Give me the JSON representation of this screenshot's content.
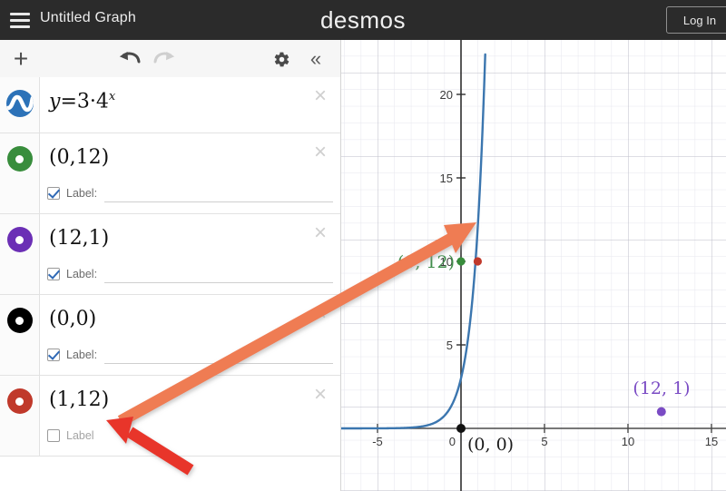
{
  "header": {
    "menu_icon": "hamburger-icon",
    "title": "Untitled Graph",
    "logo": "desmos",
    "login_label": "Log In"
  },
  "toolbar": {
    "add_label": "+",
    "undo_icon": "undo-arrow-icon",
    "redo_icon": "redo-arrow-icon",
    "settings_icon": "gear-icon",
    "collapse_icon": "double-chevron-left-icon",
    "collapse_label": "«"
  },
  "expressions": [
    {
      "index": 1,
      "type": "function",
      "icon": "curve-icon",
      "color": "#2c72b8",
      "lhs": "y",
      "eq": "=",
      "coef": "3",
      "dot": "·",
      "base": "4",
      "exp": "x",
      "close_label": "×",
      "has_label_row": false
    },
    {
      "index": 2,
      "type": "point",
      "icon": "point-icon",
      "color": "#388d3c",
      "text": "(0,12)",
      "close_label": "×",
      "has_label_row": true,
      "label_checked": true,
      "label_caption": "Label:",
      "label_value": "",
      "label_placeholder": ""
    },
    {
      "index": 3,
      "type": "point",
      "icon": "point-icon",
      "color": "#6b2fb5",
      "text": "(12,1)",
      "close_label": "×",
      "has_label_row": true,
      "label_checked": true,
      "label_caption": "Label:",
      "label_value": "",
      "label_placeholder": ""
    },
    {
      "index": 4,
      "type": "point",
      "icon": "point-icon",
      "color": "#000000",
      "text": "(0,0)",
      "close_label": "×",
      "has_label_row": true,
      "label_checked": true,
      "label_caption": "Label:",
      "label_value": "",
      "label_placeholder": ""
    },
    {
      "index": 5,
      "type": "point",
      "icon": "point-icon",
      "color": "#c0392b",
      "text": "(1,12)",
      "close_label": "×",
      "has_label_row": true,
      "label_checked": false,
      "label_caption": "Label",
      "label_value": "",
      "label_placeholder": ""
    }
  ],
  "chart_data": {
    "type": "line",
    "title": "",
    "xlabel": "",
    "ylabel": "",
    "xlim": [
      -7.2,
      15.9
    ],
    "ylim": [
      -1.6,
      22.6
    ],
    "grid": true,
    "minor_grid_step": 1,
    "major_grid_step": 5,
    "x_ticks": [
      -5,
      0,
      5,
      10,
      15
    ],
    "x_tick_labels": [
      "-5",
      "0",
      "5",
      "10",
      "15"
    ],
    "y_ticks": [
      5,
      10,
      15,
      20
    ],
    "y_tick_labels": [
      "5",
      "10",
      "15",
      "20"
    ],
    "series": [
      {
        "name": "y = 3 · 4^x",
        "type": "line",
        "color": "#3b76af",
        "expression": "y=3*4^x",
        "x_start": -7.2,
        "x_end": 1.45
      }
    ],
    "points": [
      {
        "name": "(0,12)",
        "x": 0,
        "y": 12,
        "color": "#388d3c",
        "label": "(0, 12)",
        "label_position": "left"
      },
      {
        "name": "(1,12)",
        "x": 1,
        "y": 12,
        "color": "#c0392b",
        "label": "",
        "label_position": "none"
      },
      {
        "name": "(0,0)",
        "x": 0,
        "y": 0,
        "color": "#000000",
        "label": "(0, 0)",
        "label_position": "bottom-right"
      },
      {
        "name": "(12,1)",
        "x": 12,
        "y": 1,
        "color": "#6b2fb5",
        "label": "(12, 1)",
        "label_position": "top"
      }
    ]
  },
  "annotations": [
    {
      "name": "orange-arrow",
      "color": "#ef7b52",
      "from": "(1,12) expression row",
      "to": "(0,12) graph point"
    },
    {
      "name": "red-arrow",
      "color": "#e8342a",
      "from": "lower right",
      "to": "(1,12) expression row"
    }
  ]
}
